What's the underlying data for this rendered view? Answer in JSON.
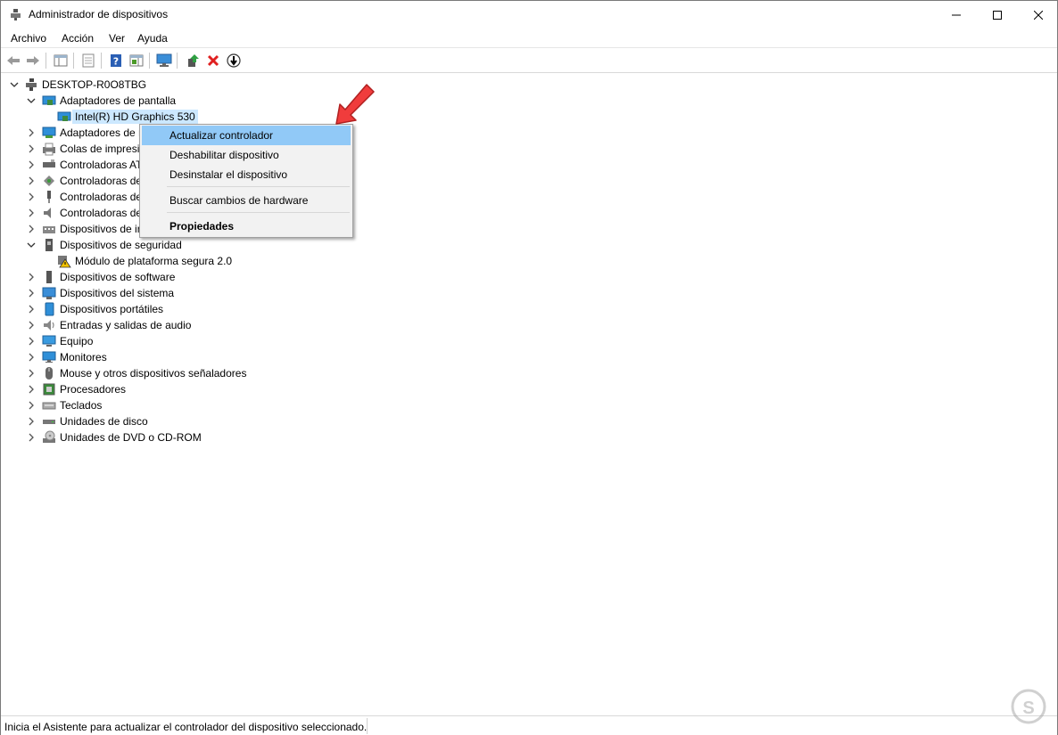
{
  "window": {
    "title": "Administrador de dispositivos"
  },
  "menu": [
    "Archivo",
    "Acción",
    "Ver",
    "Ayuda"
  ],
  "tree": {
    "root": "DESKTOP-R0O8TBG",
    "items": [
      {
        "label": "Adaptadores de pantalla",
        "expanded": true,
        "icon": "display-adapter-icon"
      },
      {
        "label": "Intel(R) HD Graphics 530",
        "child": true,
        "selected": true,
        "icon": "display-adapter-icon"
      },
      {
        "label": "Adaptadores de r",
        "icon": "network-adapter-icon"
      },
      {
        "label": "Colas de impresi",
        "icon": "print-queue-icon"
      },
      {
        "label": "Controladoras AT",
        "icon": "ata-controller-icon"
      },
      {
        "label": "Controladoras de",
        "icon": "storage-controller-icon"
      },
      {
        "label": "Controladoras de",
        "icon": "usb-controller-icon"
      },
      {
        "label": "Controladoras de",
        "icon": "sound-controller-icon"
      },
      {
        "label": "Dispositivos de ir",
        "icon": "hid-icon"
      },
      {
        "label": "Dispositivos de seguridad",
        "expanded": true,
        "icon": "security-device-icon"
      },
      {
        "label": "Módulo de plataforma segura 2.0",
        "child": true,
        "icon": "warning-device-icon"
      },
      {
        "label": "Dispositivos de software",
        "icon": "software-device-icon"
      },
      {
        "label": "Dispositivos del sistema",
        "icon": "system-device-icon"
      },
      {
        "label": "Dispositivos portátiles",
        "icon": "portable-device-icon"
      },
      {
        "label": "Entradas y salidas de audio",
        "icon": "audio-io-icon"
      },
      {
        "label": "Equipo",
        "icon": "computer-icon"
      },
      {
        "label": "Monitores",
        "icon": "monitor-icon"
      },
      {
        "label": "Mouse y otros dispositivos señaladores",
        "icon": "mouse-icon"
      },
      {
        "label": "Procesadores",
        "icon": "processor-icon"
      },
      {
        "label": "Teclados",
        "icon": "keyboard-icon"
      },
      {
        "label": "Unidades de disco",
        "icon": "disk-drive-icon"
      },
      {
        "label": "Unidades de DVD o CD-ROM",
        "icon": "dvd-drive-icon"
      }
    ]
  },
  "context_menu": {
    "update": "Actualizar controlador",
    "disable": "Deshabilitar dispositivo",
    "uninstall": "Desinstalar el dispositivo",
    "scan": "Buscar cambios de hardware",
    "properties": "Propiedades"
  },
  "status": {
    "text": "Inicia el Asistente para actualizar el controlador del dispositivo seleccionado."
  },
  "colors": {
    "selection": "#cce8ff",
    "menu_highlight": "#91c9f7",
    "arrow": "#f03c3c"
  }
}
